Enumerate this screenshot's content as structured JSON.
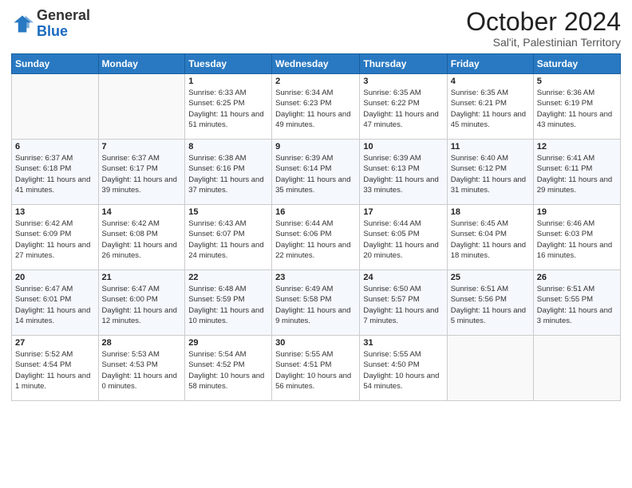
{
  "header": {
    "logo_general": "General",
    "logo_blue": "Blue",
    "month": "October 2024",
    "subtitle": "Sal'it, Palestinian Territory"
  },
  "weekdays": [
    "Sunday",
    "Monday",
    "Tuesday",
    "Wednesday",
    "Thursday",
    "Friday",
    "Saturday"
  ],
  "weeks": [
    [
      {
        "day": "",
        "info": ""
      },
      {
        "day": "",
        "info": ""
      },
      {
        "day": "1",
        "info": "Sunrise: 6:33 AM\nSunset: 6:25 PM\nDaylight: 11 hours and 51 minutes."
      },
      {
        "day": "2",
        "info": "Sunrise: 6:34 AM\nSunset: 6:23 PM\nDaylight: 11 hours and 49 minutes."
      },
      {
        "day": "3",
        "info": "Sunrise: 6:35 AM\nSunset: 6:22 PM\nDaylight: 11 hours and 47 minutes."
      },
      {
        "day": "4",
        "info": "Sunrise: 6:35 AM\nSunset: 6:21 PM\nDaylight: 11 hours and 45 minutes."
      },
      {
        "day": "5",
        "info": "Sunrise: 6:36 AM\nSunset: 6:19 PM\nDaylight: 11 hours and 43 minutes."
      }
    ],
    [
      {
        "day": "6",
        "info": "Sunrise: 6:37 AM\nSunset: 6:18 PM\nDaylight: 11 hours and 41 minutes."
      },
      {
        "day": "7",
        "info": "Sunrise: 6:37 AM\nSunset: 6:17 PM\nDaylight: 11 hours and 39 minutes."
      },
      {
        "day": "8",
        "info": "Sunrise: 6:38 AM\nSunset: 6:16 PM\nDaylight: 11 hours and 37 minutes."
      },
      {
        "day": "9",
        "info": "Sunrise: 6:39 AM\nSunset: 6:14 PM\nDaylight: 11 hours and 35 minutes."
      },
      {
        "day": "10",
        "info": "Sunrise: 6:39 AM\nSunset: 6:13 PM\nDaylight: 11 hours and 33 minutes."
      },
      {
        "day": "11",
        "info": "Sunrise: 6:40 AM\nSunset: 6:12 PM\nDaylight: 11 hours and 31 minutes."
      },
      {
        "day": "12",
        "info": "Sunrise: 6:41 AM\nSunset: 6:11 PM\nDaylight: 11 hours and 29 minutes."
      }
    ],
    [
      {
        "day": "13",
        "info": "Sunrise: 6:42 AM\nSunset: 6:09 PM\nDaylight: 11 hours and 27 minutes."
      },
      {
        "day": "14",
        "info": "Sunrise: 6:42 AM\nSunset: 6:08 PM\nDaylight: 11 hours and 26 minutes."
      },
      {
        "day": "15",
        "info": "Sunrise: 6:43 AM\nSunset: 6:07 PM\nDaylight: 11 hours and 24 minutes."
      },
      {
        "day": "16",
        "info": "Sunrise: 6:44 AM\nSunset: 6:06 PM\nDaylight: 11 hours and 22 minutes."
      },
      {
        "day": "17",
        "info": "Sunrise: 6:44 AM\nSunset: 6:05 PM\nDaylight: 11 hours and 20 minutes."
      },
      {
        "day": "18",
        "info": "Sunrise: 6:45 AM\nSunset: 6:04 PM\nDaylight: 11 hours and 18 minutes."
      },
      {
        "day": "19",
        "info": "Sunrise: 6:46 AM\nSunset: 6:03 PM\nDaylight: 11 hours and 16 minutes."
      }
    ],
    [
      {
        "day": "20",
        "info": "Sunrise: 6:47 AM\nSunset: 6:01 PM\nDaylight: 11 hours and 14 minutes."
      },
      {
        "day": "21",
        "info": "Sunrise: 6:47 AM\nSunset: 6:00 PM\nDaylight: 11 hours and 12 minutes."
      },
      {
        "day": "22",
        "info": "Sunrise: 6:48 AM\nSunset: 5:59 PM\nDaylight: 11 hours and 10 minutes."
      },
      {
        "day": "23",
        "info": "Sunrise: 6:49 AM\nSunset: 5:58 PM\nDaylight: 11 hours and 9 minutes."
      },
      {
        "day": "24",
        "info": "Sunrise: 6:50 AM\nSunset: 5:57 PM\nDaylight: 11 hours and 7 minutes."
      },
      {
        "day": "25",
        "info": "Sunrise: 6:51 AM\nSunset: 5:56 PM\nDaylight: 11 hours and 5 minutes."
      },
      {
        "day": "26",
        "info": "Sunrise: 6:51 AM\nSunset: 5:55 PM\nDaylight: 11 hours and 3 minutes."
      }
    ],
    [
      {
        "day": "27",
        "info": "Sunrise: 5:52 AM\nSunset: 4:54 PM\nDaylight: 11 hours and 1 minute."
      },
      {
        "day": "28",
        "info": "Sunrise: 5:53 AM\nSunset: 4:53 PM\nDaylight: 11 hours and 0 minutes."
      },
      {
        "day": "29",
        "info": "Sunrise: 5:54 AM\nSunset: 4:52 PM\nDaylight: 10 hours and 58 minutes."
      },
      {
        "day": "30",
        "info": "Sunrise: 5:55 AM\nSunset: 4:51 PM\nDaylight: 10 hours and 56 minutes."
      },
      {
        "day": "31",
        "info": "Sunrise: 5:55 AM\nSunset: 4:50 PM\nDaylight: 10 hours and 54 minutes."
      },
      {
        "day": "",
        "info": ""
      },
      {
        "day": "",
        "info": ""
      }
    ]
  ]
}
